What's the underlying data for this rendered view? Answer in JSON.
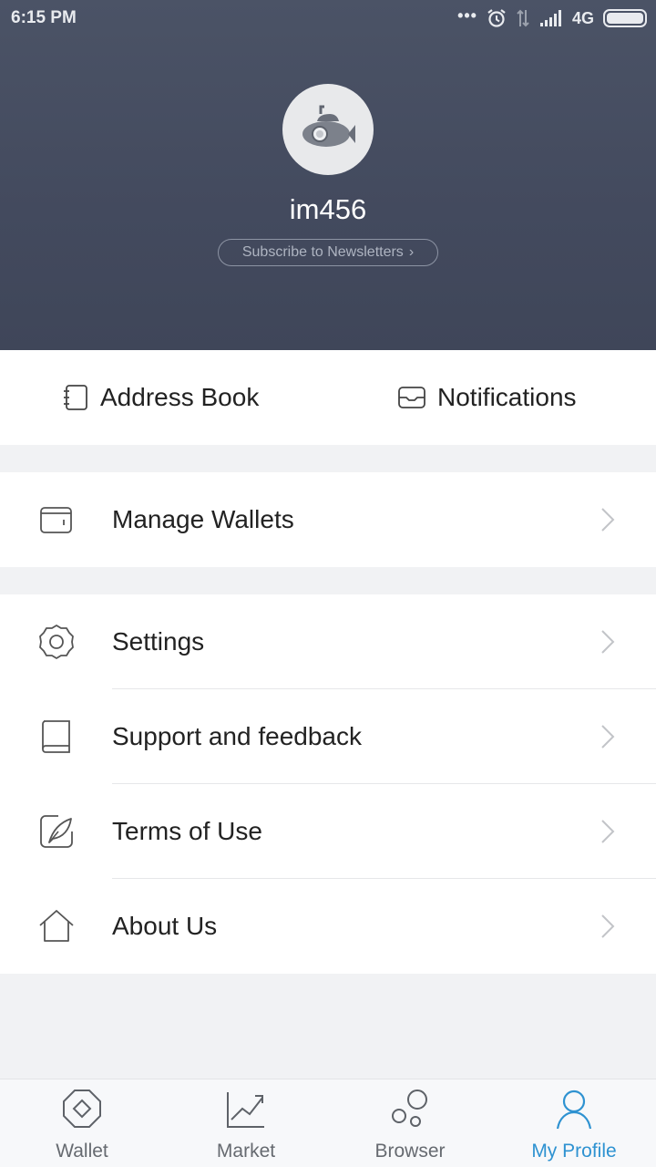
{
  "status_bar": {
    "time": "6:15 PM",
    "dots": "•••",
    "network": "4G"
  },
  "profile": {
    "username": "im456",
    "subscribe_label": "Subscribe to Newsletters",
    "subscribe_chevron": "›"
  },
  "quick_actions": [
    {
      "label": "Address Book",
      "icon": "address-book-icon"
    },
    {
      "label": "Notifications",
      "icon": "inbox-icon"
    }
  ],
  "menu": {
    "group1": [
      {
        "label": "Manage Wallets",
        "icon": "wallet-icon"
      }
    ],
    "group2": [
      {
        "label": "Settings",
        "icon": "gear-icon"
      },
      {
        "label": "Support and feedback",
        "icon": "book-icon"
      },
      {
        "label": "Terms of Use",
        "icon": "feather-icon"
      },
      {
        "label": "About Us",
        "icon": "home-icon"
      }
    ]
  },
  "bottom_nav": [
    {
      "label": "Wallet",
      "icon": "octagon-diamond-icon",
      "active": false
    },
    {
      "label": "Market",
      "icon": "chart-trend-icon",
      "active": false
    },
    {
      "label": "Browser",
      "icon": "bubbles-icon",
      "active": false
    },
    {
      "label": "My Profile",
      "icon": "person-icon",
      "active": true
    }
  ],
  "colors": {
    "header": "#464e61",
    "accent": "#2e92d1",
    "background": "#f1f2f4"
  }
}
